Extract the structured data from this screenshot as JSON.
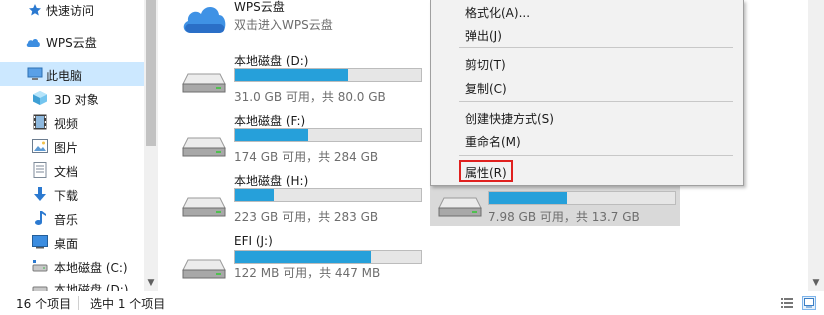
{
  "sidebar": {
    "items": [
      {
        "id": "quick-access",
        "label": "快速访问",
        "icon": "star-icon"
      },
      {
        "id": "wps-cloud",
        "label": "WPS云盘",
        "icon": "cloud-icon"
      },
      {
        "id": "this-pc",
        "label": "此电脑",
        "icon": "computer-icon",
        "selected": true
      },
      {
        "id": "3d-objects",
        "label": "3D 对象",
        "icon": "cube-icon"
      },
      {
        "id": "videos",
        "label": "视频",
        "icon": "film-icon"
      },
      {
        "id": "pictures",
        "label": "图片",
        "icon": "picture-icon"
      },
      {
        "id": "documents",
        "label": "文档",
        "icon": "document-icon"
      },
      {
        "id": "downloads",
        "label": "下载",
        "icon": "download-arrow-icon"
      },
      {
        "id": "music",
        "label": "音乐",
        "icon": "music-note-icon"
      },
      {
        "id": "desktop",
        "label": "桌面",
        "icon": "desktop-icon"
      },
      {
        "id": "drive-c",
        "label": "本地磁盘 (C:)",
        "icon": "drive-icon"
      },
      {
        "id": "drive-d",
        "label": "本地磁盘 (D:)",
        "icon": "drive-icon"
      }
    ]
  },
  "main": {
    "wps": {
      "name": "WPS云盘",
      "subtitle": "双击进入WPS云盘",
      "icon": "wps-cloud-icon"
    },
    "drives": [
      {
        "name": "本地磁盘 (D:)",
        "usage": "31.0 GB 可用，共 80.0 GB",
        "used_fraction": 0.61
      },
      {
        "name": "本地磁盘 (F:)",
        "usage": "174 GB 可用，共 284 GB",
        "used_fraction": 0.39
      },
      {
        "name": "本地磁盘 (H:)",
        "usage": "223 GB 可用，共 283 GB",
        "used_fraction": 0.21
      },
      {
        "name": "EFI (J:)",
        "usage": "122 MB 可用，共 447 MB",
        "used_fraction": 0.73
      },
      {
        "name": "",
        "usage": "7.98 GB 可用，共 13.7 GB",
        "used_fraction": 0.42,
        "selected": true
      }
    ]
  },
  "context_menu": {
    "items": {
      "format": "格式化(A)...",
      "eject": "弹出(J)",
      "cut": "剪切(T)",
      "copy": "复制(C)",
      "create_shortcut": "创建快捷方式(S)",
      "rename": "重命名(M)",
      "properties": "属性(R)"
    },
    "highlight_color": "#e0211f"
  },
  "statusbar": {
    "item_count": "16 个项目",
    "selected_count": "选中 1 个项目"
  },
  "colors": {
    "accent": "#26a0da",
    "selection": "#cce8ff"
  }
}
